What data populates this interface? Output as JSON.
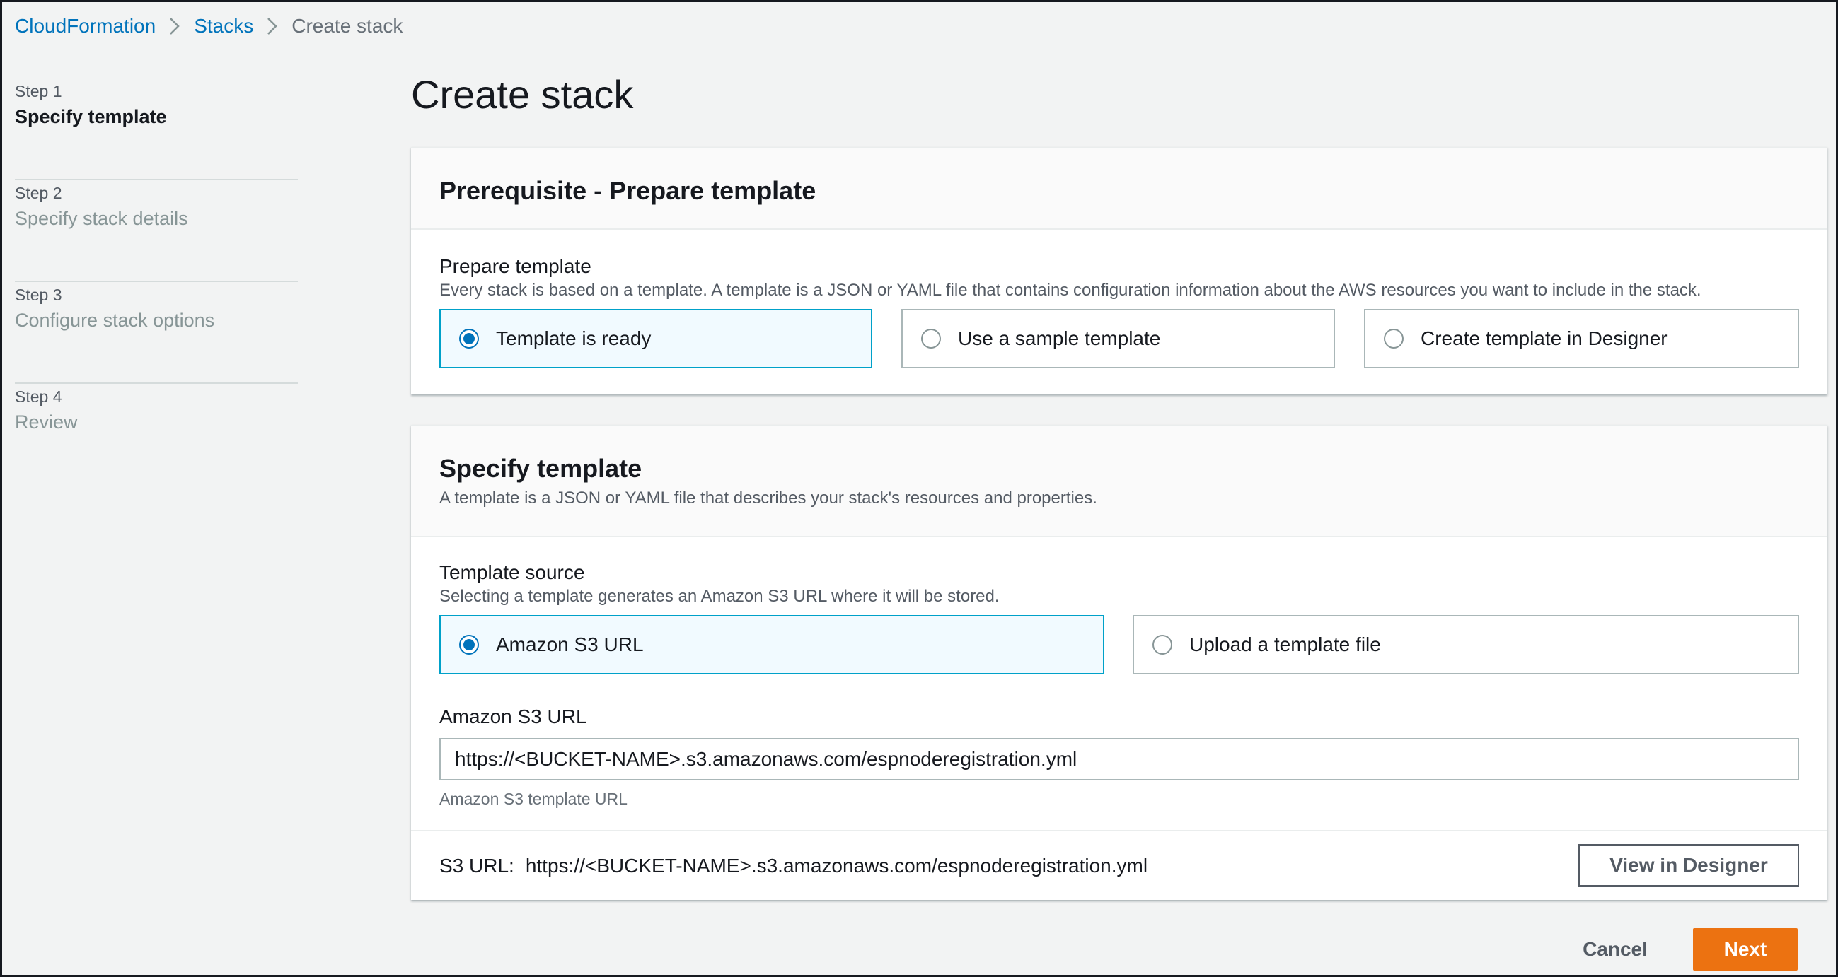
{
  "breadcrumb": {
    "items": [
      "CloudFormation",
      "Stacks",
      "Create stack"
    ],
    "separator_icon": "chevron-right-icon"
  },
  "sidenav": {
    "steps": [
      {
        "number": "Step 1",
        "title": "Specify template",
        "active": true
      },
      {
        "number": "Step 2",
        "title": "Specify stack details",
        "active": false
      },
      {
        "number": "Step 3",
        "title": "Configure stack options",
        "active": false
      },
      {
        "number": "Step 4",
        "title": "Review",
        "active": false
      }
    ]
  },
  "page": {
    "title": "Create stack"
  },
  "prerequisite": {
    "header": "Prerequisite - Prepare template",
    "field_label": "Prepare template",
    "field_description": "Every stack is based on a template. A template is a JSON or YAML file that contains configuration information about the AWS resources you want to include in the stack.",
    "options": [
      {
        "label": "Template is ready",
        "selected": true
      },
      {
        "label": "Use a sample template",
        "selected": false
      },
      {
        "label": "Create template in Designer",
        "selected": false
      }
    ]
  },
  "specify": {
    "header": "Specify template",
    "description": "A template is a JSON or YAML file that describes your stack's resources and properties.",
    "source_label": "Template source",
    "source_description": "Selecting a template generates an Amazon S3 URL where it will be stored.",
    "source_options": [
      {
        "label": "Amazon S3 URL",
        "selected": true
      },
      {
        "label": "Upload a template file",
        "selected": false
      }
    ],
    "url_label": "Amazon S3 URL",
    "url_value": "https://<BUCKET-NAME>.s3.amazonaws.com/espnoderegistration.yml",
    "url_help": "Amazon S3 template URL",
    "s3url_prefix": "S3 URL:",
    "s3url_value": "https://<BUCKET-NAME>.s3.amazonaws.com/espnoderegistration.yml",
    "view_designer_label": "View in Designer"
  },
  "actions": {
    "cancel_label": "Cancel",
    "next_label": "Next"
  },
  "colors": {
    "link": "#0073bb",
    "primary_button": "#ec7211",
    "selected_tile_border": "#00a1c9",
    "selected_tile_bg": "#f1faff",
    "radio_checked": "#0073bb"
  }
}
